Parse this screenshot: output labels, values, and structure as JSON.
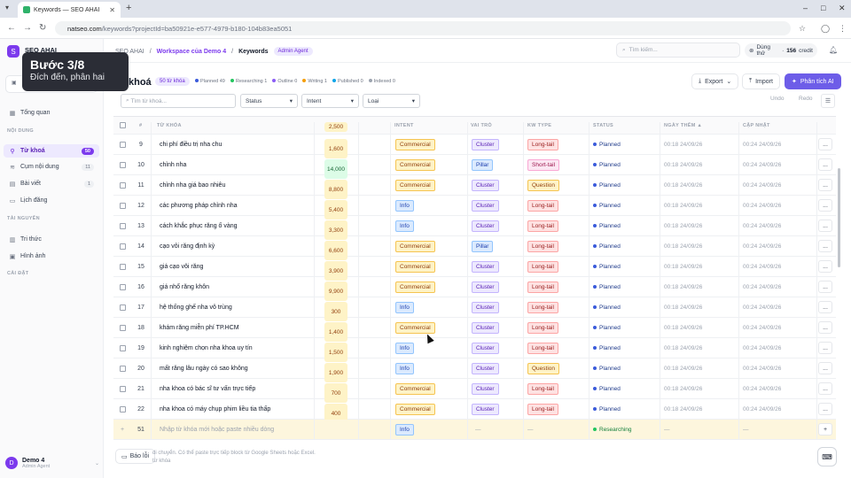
{
  "browser": {
    "tab_title": "Keywords — SEO AHAI",
    "tab_close": "✕",
    "new_tab": "+",
    "url_host": "natseo.com",
    "url_path": "/keywords?projectId=ba50921e-e577-4979-b180-104b83ea5051"
  },
  "app": {
    "brand": "SEO AHAI",
    "logo_glyph": "S"
  },
  "tour": {
    "step": "Bước 3/8",
    "subtitle": "Đích đến, phân hai"
  },
  "sidebar": {
    "overview": "Tổng quan",
    "section_content": "NỘI DUNG",
    "section_resources": "TÀI NGUYÊN",
    "section_settings": "CÀI ĐẶT",
    "items": [
      {
        "label": "Từ khoá",
        "count": "50"
      },
      {
        "label": "Cụm nội dung",
        "count": "11"
      },
      {
        "label": "Bài viết",
        "count": "1"
      },
      {
        "label": "Lịch đăng",
        "count": ""
      }
    ],
    "resources": [
      {
        "label": "Tri thức"
      },
      {
        "label": "Hình ảnh"
      }
    ],
    "user_name": "Demo 4",
    "user_role": "Admin Agent",
    "user_initial": "D"
  },
  "topbar": {
    "crumb_root": "SEO AHAI",
    "crumb_ws": "Workspace của Demo 4",
    "crumb_cur": "Keywords",
    "crumb_badge": "Admin Agent",
    "search_placeholder": "Tìm kiếm...",
    "plan_label": "Dùng thử",
    "credit_count": "156",
    "credit_unit": "credit"
  },
  "header": {
    "title": "khoá",
    "count_pill": "50 từ khóa",
    "stats": [
      {
        "label": "Planned",
        "value": "49",
        "color": "#3b5bdb"
      },
      {
        "label": "Researching",
        "value": "1",
        "color": "#22c55e"
      },
      {
        "label": "Outline",
        "value": "0",
        "color": "#8b5cf6"
      },
      {
        "label": "Writing",
        "value": "1",
        "color": "#f59e0b"
      },
      {
        "label": "Published",
        "value": "0",
        "color": "#0ea5e9"
      },
      {
        "label": "Indexed",
        "value": "0",
        "color": "#9ca3af"
      }
    ],
    "export": "Export",
    "import": "Import",
    "analyze": "Phân tích AI",
    "filter_placeholder": "Tìm từ khoá...",
    "status_select": "Status",
    "intent_select": "Intent",
    "type_select": "Loại",
    "undo": "Undo",
    "redo": "Redo"
  },
  "table": {
    "headers": {
      "num": "#",
      "keyword": "TỪ KHÓA",
      "intent": "INTENT",
      "role": "VAI TRÒ",
      "kwtype": "KW TYPE",
      "status": "STATUS",
      "created": "NGÀY THÊM ▲",
      "updated": "CẬP NHẬT"
    },
    "partial_row": {
      "vol": "2,500"
    },
    "rows": [
      {
        "n": "9",
        "kw": "chi phí điều trị nha chu",
        "vol": "1,600",
        "intent": "Commercial",
        "role": "Cluster",
        "type": "Long-tail",
        "status": "Planned",
        "created": "00:18 24/09/26",
        "updated": "00:24 24/09/26"
      },
      {
        "n": "10",
        "kw": "chỉnh nha",
        "vol": "14,000",
        "intent": "Commercial",
        "role": "Pillar",
        "type": "Short-tail",
        "status": "Planned",
        "created": "00:18 24/09/26",
        "updated": "00:24 24/09/26"
      },
      {
        "n": "11",
        "kw": "chỉnh nha giá bao nhiêu",
        "vol": "8,800",
        "intent": "Commercial",
        "role": "Cluster",
        "type": "Question",
        "status": "Planned",
        "created": "00:18 24/09/26",
        "updated": "00:24 24/09/26"
      },
      {
        "n": "12",
        "kw": "các phương pháp chỉnh nha",
        "vol": "5,400",
        "intent": "Info",
        "role": "Cluster",
        "type": "Long-tail",
        "status": "Planned",
        "created": "00:18 24/09/26",
        "updated": "00:24 24/09/26"
      },
      {
        "n": "13",
        "kw": "cách khắc phục răng ố vàng",
        "vol": "3,300",
        "intent": "Info",
        "role": "Cluster",
        "type": "Long-tail",
        "status": "Planned",
        "created": "00:18 24/09/26",
        "updated": "00:24 24/09/26"
      },
      {
        "n": "14",
        "kw": "cạo vôi răng định kỳ",
        "vol": "6,600",
        "intent": "Commercial",
        "role": "Pillar",
        "type": "Long-tail",
        "status": "Planned",
        "created": "00:18 24/09/26",
        "updated": "00:24 24/09/26"
      },
      {
        "n": "15",
        "kw": "giá cạo vôi răng",
        "vol": "3,900",
        "intent": "Commercial",
        "role": "Cluster",
        "type": "Long-tail",
        "status": "Planned",
        "created": "00:18 24/09/26",
        "updated": "00:24 24/09/26"
      },
      {
        "n": "16",
        "kw": "giá nhổ răng khôn",
        "vol": "9,900",
        "intent": "Commercial",
        "role": "Cluster",
        "type": "Long-tail",
        "status": "Planned",
        "created": "00:18 24/09/26",
        "updated": "00:24 24/09/26"
      },
      {
        "n": "17",
        "kw": "hệ thống ghế nha vô trùng",
        "vol": "300",
        "intent": "Info",
        "role": "Cluster",
        "type": "Long-tail",
        "status": "Planned",
        "created": "00:18 24/09/26",
        "updated": "00:24 24/09/26"
      },
      {
        "n": "18",
        "kw": "khám răng miễn phí TP.HCM",
        "vol": "1,400",
        "intent": "Commercial",
        "role": "Cluster",
        "type": "Long-tail",
        "status": "Planned",
        "created": "00:18 24/09/26",
        "updated": "00:24 24/09/26"
      },
      {
        "n": "19",
        "kw": "kinh nghiệm chọn nha khoa uy tín",
        "vol": "1,500",
        "intent": "Info",
        "role": "Cluster",
        "type": "Long-tail",
        "status": "Planned",
        "created": "00:18 24/09/26",
        "updated": "00:24 24/09/26"
      },
      {
        "n": "20",
        "kw": "mất răng lâu ngày có sao không",
        "vol": "1,900",
        "intent": "Info",
        "role": "Cluster",
        "type": "Question",
        "status": "Planned",
        "created": "00:18 24/09/26",
        "updated": "00:24 24/09/26"
      },
      {
        "n": "21",
        "kw": "nha khoa có bác sĩ tư vấn trực tiếp",
        "vol": "700",
        "intent": "Commercial",
        "role": "Cluster",
        "type": "Long-tail",
        "status": "Planned",
        "created": "00:18 24/09/26",
        "updated": "00:24 24/09/26"
      },
      {
        "n": "22",
        "kw": "nha khoa có máy chụp phim liều tia thấp",
        "vol": "400",
        "intent": "Commercial",
        "role": "Cluster",
        "type": "Long-tail",
        "status": "Planned",
        "created": "00:18 24/09/26",
        "updated": "00:24 24/09/26"
      }
    ],
    "more_glyph": "...",
    "new_row": {
      "plus": "+",
      "n": "51",
      "placeholder": "Nhập từ khóa mới hoặc paste nhiều dòng",
      "intent": "Info",
      "dash": "—",
      "status": "Researching"
    }
  },
  "footer": {
    "report": "Báo lỗi",
    "hint_line1": "di chuyển. Có thể paste trực tiếp block từ Google Sheets hoặc Excel.",
    "hint_line2": "từ khóa"
  }
}
